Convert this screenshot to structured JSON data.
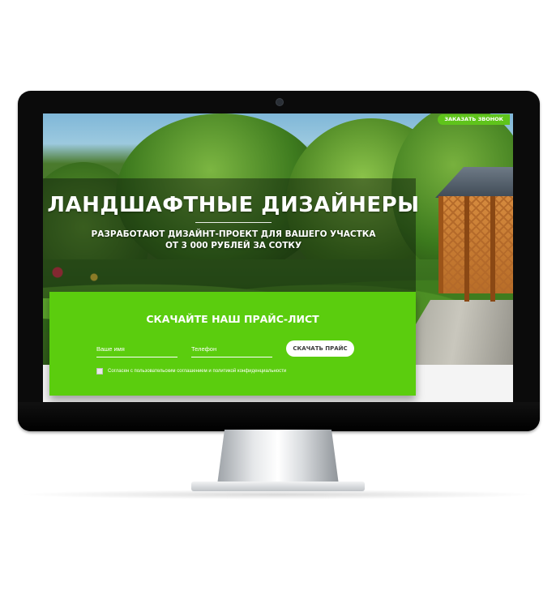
{
  "header": {
    "call_button": "ЗАКАЗАТЬ ЗВОНОК"
  },
  "hero": {
    "title": "ЛАНДШАФТНЫЕ ДИЗАЙНЕРЫ",
    "subtitle": "РАЗРАБОТАЮТ ДИЗАЙНТ-ПРОЕКТ ДЛЯ ВАШЕГО УЧАСТКА ОТ 3 000 РУБЛЕЙ ЗА СОТКУ"
  },
  "form": {
    "title": "СКАЧАЙТЕ НАШ ПРАЙС-ЛИСТ",
    "name_placeholder": "Ваше имя",
    "phone_placeholder": "Телефон",
    "submit_label": "СКАЧАТЬ ПРАЙС",
    "consent_text": "Согласен с пользовательским соглашением и политикой конфиденциальности",
    "consent_checked": false
  },
  "colors": {
    "accent_green": "#5bcd0e",
    "button_text": "#3a3a3a"
  }
}
